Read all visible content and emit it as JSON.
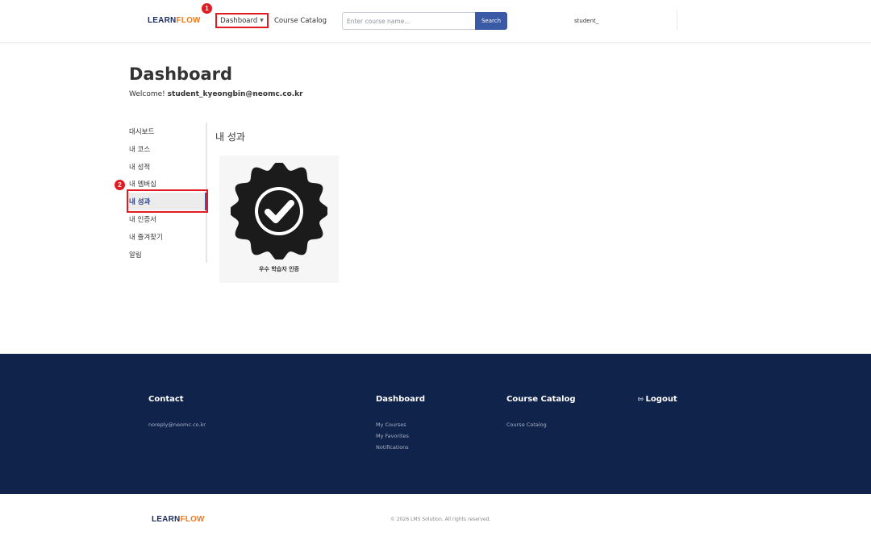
{
  "header": {
    "logo": {
      "learn": "LEARN",
      "flow": "FLOW"
    },
    "nav": {
      "dashboard": "Dashboard",
      "catalog": "Course Catalog"
    },
    "search": {
      "placeholder": "Enter course name...",
      "value": "",
      "button": "Search"
    },
    "user": "student_"
  },
  "annotations": {
    "badge1": "1",
    "badge2": "2",
    "color": "#e11b22"
  },
  "main": {
    "title": "Dashboard",
    "welcome_prefix": "Welcome!",
    "welcome_user": "student_kyeongbin@neomc.co.kr",
    "sidebar": [
      {
        "label": "대시보드"
      },
      {
        "label": "내 코스"
      },
      {
        "label": "내 성적"
      },
      {
        "label": "내 멤버십"
      },
      {
        "label": "내 성과",
        "active": true
      },
      {
        "label": "내 인증서"
      },
      {
        "label": "내 즐겨찾기"
      },
      {
        "label": "알림"
      }
    ],
    "section_title": "내 성과",
    "achievement": {
      "label": "우수 학습자 인증",
      "icon": "verified-badge-icon"
    }
  },
  "footer": {
    "contact": {
      "title": "Contact",
      "email": "noreply@neomc.co.kr"
    },
    "dashboard": {
      "title": "Dashboard",
      "links": [
        "My Courses",
        "My Favorites",
        "Notifications"
      ]
    },
    "catalog": {
      "title": "Course Catalog",
      "links": [
        "Course Catalog"
      ]
    },
    "logout": "Logout",
    "copyright": "© 2026 LMS Solution. All rights reserved.",
    "colors": {
      "background": "#10234a",
      "accent": "#3a5aa6",
      "brand_orange": "#f07b1d"
    }
  }
}
